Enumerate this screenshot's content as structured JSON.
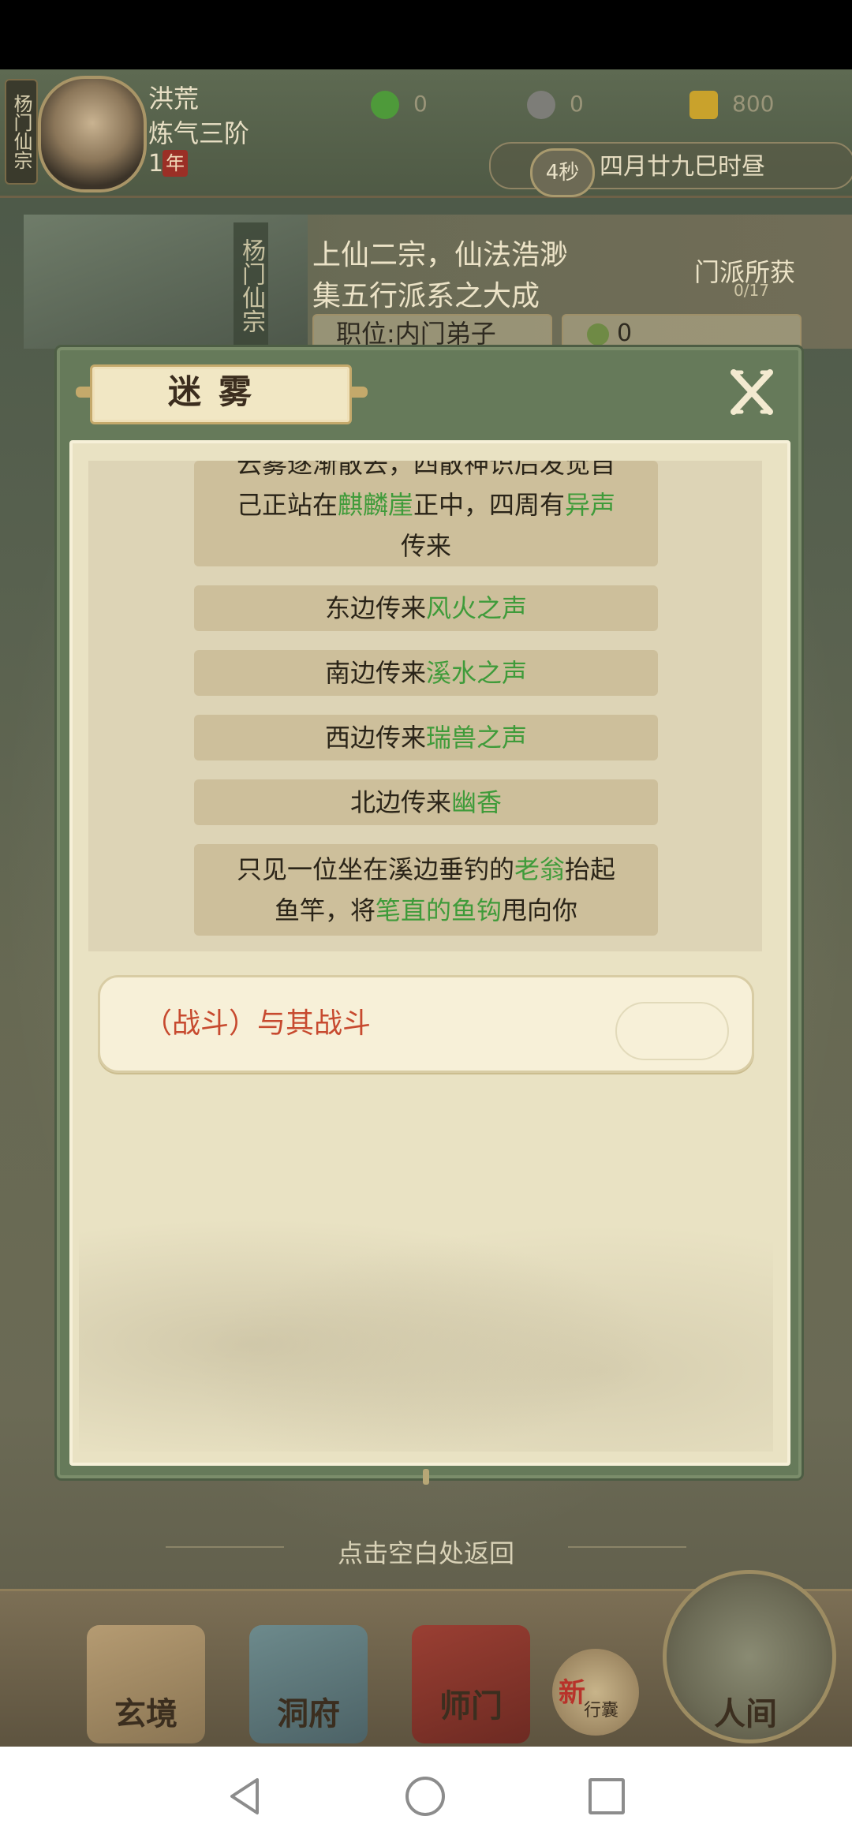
{
  "header": {
    "sect_tag": "杨门仙宗",
    "player_name": "洪荒",
    "player_rank": "炼气三阶",
    "year_num": "1",
    "year_badge": "年",
    "resources": [
      {
        "icon": "jade-leaf-icon",
        "value": "0",
        "color": "#4e9a3a"
      },
      {
        "icon": "coin-icon",
        "value": "0",
        "color": "#7d7d78"
      },
      {
        "icon": "gold-ingot-icon",
        "value": "800",
        "color": "#c9a22c"
      }
    ],
    "timer_seconds": "4秒",
    "timer_date": "四月廿九巳时昼"
  },
  "sect": {
    "vertical_name": "杨门仙宗",
    "motto_line1": "上仙二宗，仙法浩渺",
    "motto_line2": "集五行派系之大成",
    "gain_label": "门派所获",
    "gain_count": "0/17",
    "position": "职位:内门弟子",
    "score": "0"
  },
  "dialog": {
    "title": "迷雾",
    "close_icon": "close-x-icon",
    "story": [
      {
        "parts": [
          {
            "t": "云雾逐渐散去，四散神识后发觉自",
            "hl": false
          }
        ]
      },
      {
        "parts": [
          {
            "t": "己正站在",
            "hl": false
          },
          {
            "t": "麒麟崖",
            "hl": true
          },
          {
            "t": "正中，四周有",
            "hl": false
          },
          {
            "t": "异声",
            "hl": true
          }
        ]
      },
      {
        "parts": [
          {
            "t": "传来",
            "hl": false
          }
        ]
      }
    ],
    "lines": [
      {
        "parts": [
          {
            "t": "东边传来",
            "hl": false
          },
          {
            "t": "风火之声",
            "hl": true
          }
        ]
      },
      {
        "parts": [
          {
            "t": "南边传来",
            "hl": false
          },
          {
            "t": "溪水之声",
            "hl": true
          }
        ]
      },
      {
        "parts": [
          {
            "t": "西边传来",
            "hl": false
          },
          {
            "t": "瑞兽之声",
            "hl": true
          }
        ]
      },
      {
        "parts": [
          {
            "t": "北边传来",
            "hl": false
          },
          {
            "t": "幽香",
            "hl": true
          }
        ]
      }
    ],
    "last": [
      {
        "parts": [
          {
            "t": "只见一位坐在溪边垂钓的",
            "hl": false
          },
          {
            "t": "老翁",
            "hl": true
          },
          {
            "t": "抬起",
            "hl": false
          }
        ]
      },
      {
        "parts": [
          {
            "t": "鱼竿，将",
            "hl": false
          },
          {
            "t": "笔直的鱼钩",
            "hl": true
          },
          {
            "t": "甩向你",
            "hl": false
          }
        ]
      }
    ],
    "choice": "（战斗）与其战斗"
  },
  "return_hint": "点击空白处返回",
  "tabs": [
    {
      "label": "玄境",
      "icon": "scroll-icon"
    },
    {
      "label": "洞府",
      "icon": "pavilion-icon"
    },
    {
      "label": "师门",
      "icon": "banner-icon"
    },
    {
      "label": "行囊",
      "icon": "bag-icon",
      "badge": "新"
    },
    {
      "label": "人间",
      "icon": "mountain-icon"
    }
  ],
  "colors": {
    "highlight": "#3f9b3a",
    "choice": "#c74a2f"
  }
}
